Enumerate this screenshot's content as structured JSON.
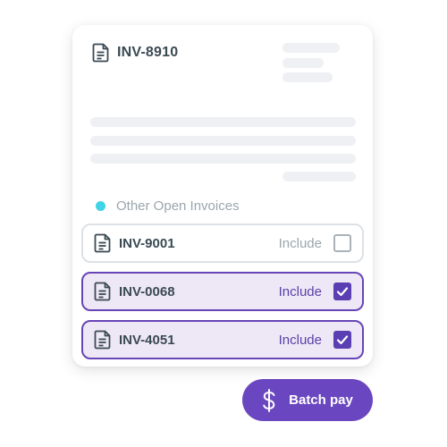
{
  "header": {
    "invoice_id": "INV-8910",
    "icon": "document-icon"
  },
  "section": {
    "label": "Other Open Invoices",
    "dot_color": "#41d3e6"
  },
  "invoices": [
    {
      "id": "INV-9001",
      "include_label": "Include",
      "included": false
    },
    {
      "id": "INV-0068",
      "include_label": "Include",
      "included": true
    },
    {
      "id": "INV-4051",
      "include_label": "Include",
      "included": true
    }
  ],
  "action": {
    "label": "Batch pay",
    "icon": "dollar-icon",
    "color": "#6a47c0"
  },
  "colors": {
    "selected_border": "#6745b7",
    "selected_bg": "#eee8f6",
    "checkbox_checked": "#5b3eb2"
  }
}
